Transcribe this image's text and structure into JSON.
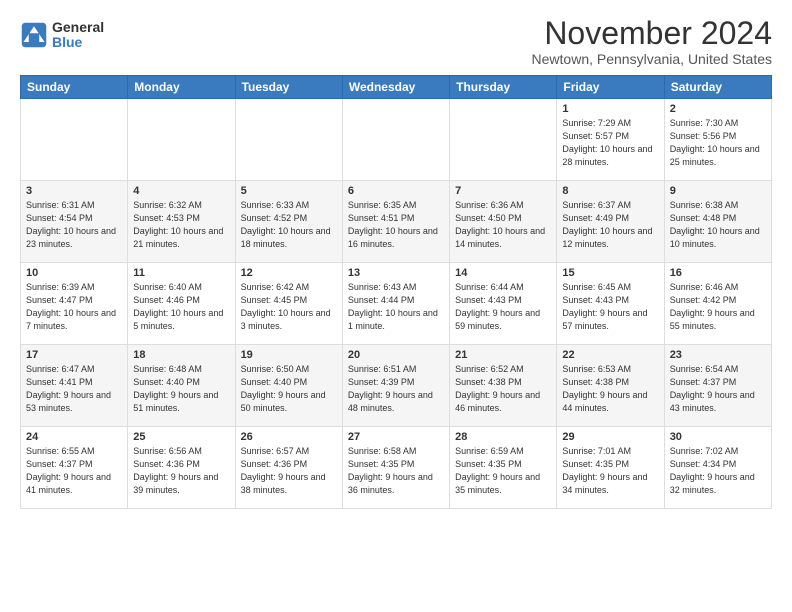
{
  "logo": {
    "general": "General",
    "blue": "Blue"
  },
  "title": "November 2024",
  "location": "Newtown, Pennsylvania, United States",
  "weekdays": [
    "Sunday",
    "Monday",
    "Tuesday",
    "Wednesday",
    "Thursday",
    "Friday",
    "Saturday"
  ],
  "weeks": [
    [
      {
        "day": "",
        "info": ""
      },
      {
        "day": "",
        "info": ""
      },
      {
        "day": "",
        "info": ""
      },
      {
        "day": "",
        "info": ""
      },
      {
        "day": "",
        "info": ""
      },
      {
        "day": "1",
        "info": "Sunrise: 7:29 AM\nSunset: 5:57 PM\nDaylight: 10 hours and 28 minutes."
      },
      {
        "day": "2",
        "info": "Sunrise: 7:30 AM\nSunset: 5:56 PM\nDaylight: 10 hours and 25 minutes."
      }
    ],
    [
      {
        "day": "3",
        "info": "Sunrise: 6:31 AM\nSunset: 4:54 PM\nDaylight: 10 hours and 23 minutes."
      },
      {
        "day": "4",
        "info": "Sunrise: 6:32 AM\nSunset: 4:53 PM\nDaylight: 10 hours and 21 minutes."
      },
      {
        "day": "5",
        "info": "Sunrise: 6:33 AM\nSunset: 4:52 PM\nDaylight: 10 hours and 18 minutes."
      },
      {
        "day": "6",
        "info": "Sunrise: 6:35 AM\nSunset: 4:51 PM\nDaylight: 10 hours and 16 minutes."
      },
      {
        "day": "7",
        "info": "Sunrise: 6:36 AM\nSunset: 4:50 PM\nDaylight: 10 hours and 14 minutes."
      },
      {
        "day": "8",
        "info": "Sunrise: 6:37 AM\nSunset: 4:49 PM\nDaylight: 10 hours and 12 minutes."
      },
      {
        "day": "9",
        "info": "Sunrise: 6:38 AM\nSunset: 4:48 PM\nDaylight: 10 hours and 10 minutes."
      }
    ],
    [
      {
        "day": "10",
        "info": "Sunrise: 6:39 AM\nSunset: 4:47 PM\nDaylight: 10 hours and 7 minutes."
      },
      {
        "day": "11",
        "info": "Sunrise: 6:40 AM\nSunset: 4:46 PM\nDaylight: 10 hours and 5 minutes."
      },
      {
        "day": "12",
        "info": "Sunrise: 6:42 AM\nSunset: 4:45 PM\nDaylight: 10 hours and 3 minutes."
      },
      {
        "day": "13",
        "info": "Sunrise: 6:43 AM\nSunset: 4:44 PM\nDaylight: 10 hours and 1 minute."
      },
      {
        "day": "14",
        "info": "Sunrise: 6:44 AM\nSunset: 4:43 PM\nDaylight: 9 hours and 59 minutes."
      },
      {
        "day": "15",
        "info": "Sunrise: 6:45 AM\nSunset: 4:43 PM\nDaylight: 9 hours and 57 minutes."
      },
      {
        "day": "16",
        "info": "Sunrise: 6:46 AM\nSunset: 4:42 PM\nDaylight: 9 hours and 55 minutes."
      }
    ],
    [
      {
        "day": "17",
        "info": "Sunrise: 6:47 AM\nSunset: 4:41 PM\nDaylight: 9 hours and 53 minutes."
      },
      {
        "day": "18",
        "info": "Sunrise: 6:48 AM\nSunset: 4:40 PM\nDaylight: 9 hours and 51 minutes."
      },
      {
        "day": "19",
        "info": "Sunrise: 6:50 AM\nSunset: 4:40 PM\nDaylight: 9 hours and 50 minutes."
      },
      {
        "day": "20",
        "info": "Sunrise: 6:51 AM\nSunset: 4:39 PM\nDaylight: 9 hours and 48 minutes."
      },
      {
        "day": "21",
        "info": "Sunrise: 6:52 AM\nSunset: 4:38 PM\nDaylight: 9 hours and 46 minutes."
      },
      {
        "day": "22",
        "info": "Sunrise: 6:53 AM\nSunset: 4:38 PM\nDaylight: 9 hours and 44 minutes."
      },
      {
        "day": "23",
        "info": "Sunrise: 6:54 AM\nSunset: 4:37 PM\nDaylight: 9 hours and 43 minutes."
      }
    ],
    [
      {
        "day": "24",
        "info": "Sunrise: 6:55 AM\nSunset: 4:37 PM\nDaylight: 9 hours and 41 minutes."
      },
      {
        "day": "25",
        "info": "Sunrise: 6:56 AM\nSunset: 4:36 PM\nDaylight: 9 hours and 39 minutes."
      },
      {
        "day": "26",
        "info": "Sunrise: 6:57 AM\nSunset: 4:36 PM\nDaylight: 9 hours and 38 minutes."
      },
      {
        "day": "27",
        "info": "Sunrise: 6:58 AM\nSunset: 4:35 PM\nDaylight: 9 hours and 36 minutes."
      },
      {
        "day": "28",
        "info": "Sunrise: 6:59 AM\nSunset: 4:35 PM\nDaylight: 9 hours and 35 minutes."
      },
      {
        "day": "29",
        "info": "Sunrise: 7:01 AM\nSunset: 4:35 PM\nDaylight: 9 hours and 34 minutes."
      },
      {
        "day": "30",
        "info": "Sunrise: 7:02 AM\nSunset: 4:34 PM\nDaylight: 9 hours and 32 minutes."
      }
    ]
  ]
}
